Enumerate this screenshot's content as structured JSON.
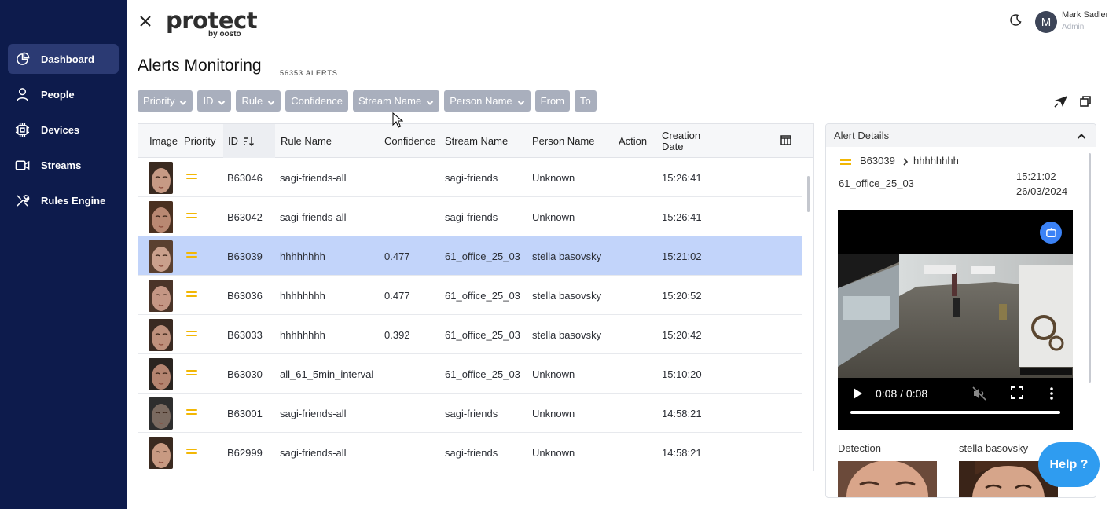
{
  "sidebar": {
    "items": [
      {
        "label": "Dashboard",
        "icon": "dashboard-icon",
        "active": true
      },
      {
        "label": "People",
        "icon": "person-icon"
      },
      {
        "label": "Devices",
        "icon": "chip-icon"
      },
      {
        "label": "Streams",
        "icon": "video-camera-icon"
      },
      {
        "label": "Rules Engine",
        "icon": "tools-icon"
      }
    ]
  },
  "header": {
    "logo_main": "protect",
    "logo_sub": "by oosto",
    "user_initial": "M",
    "user_name": "Mark Sadler",
    "user_role": "Admin"
  },
  "page": {
    "title": "Alerts Monitoring",
    "count": "56353 ALERTS"
  },
  "filters": [
    {
      "label": "Priority",
      "dropdown": true
    },
    {
      "label": "ID",
      "dropdown": true
    },
    {
      "label": "Rule",
      "dropdown": true
    },
    {
      "label": "Confidence",
      "dropdown": false
    },
    {
      "label": "Stream Name",
      "dropdown": true
    },
    {
      "label": "Person Name",
      "dropdown": true
    },
    {
      "label": "From",
      "dropdown": false
    },
    {
      "label": "To",
      "dropdown": false
    }
  ],
  "table": {
    "headers": {
      "image": "Image",
      "priority": "Priority",
      "id": "ID",
      "rule": "Rule Name",
      "confidence": "Confidence",
      "stream": "Stream Name",
      "person": "Person Name",
      "action": "Action",
      "date_line1": "Creation",
      "date_line2": "Date"
    },
    "rows": [
      {
        "id": "B63046",
        "rule": "sagi-friends-all",
        "confidence": "",
        "stream": "sagi-friends",
        "person": "Unknown",
        "time": "15:26:41",
        "selected": false
      },
      {
        "id": "B63042",
        "rule": "sagi-friends-all",
        "confidence": "",
        "stream": "sagi-friends",
        "person": "Unknown",
        "time": "15:26:41",
        "selected": false
      },
      {
        "id": "B63039",
        "rule": "hhhhhhhh",
        "confidence": "0.477",
        "stream": "61_office_25_03",
        "person": "stella basovsky",
        "time": "15:21:02",
        "selected": true
      },
      {
        "id": "B63036",
        "rule": "hhhhhhhh",
        "confidence": "0.477",
        "stream": "61_office_25_03",
        "person": "stella basovsky",
        "time": "15:20:52",
        "selected": false
      },
      {
        "id": "B63033",
        "rule": "hhhhhhhh",
        "confidence": "0.392",
        "stream": "61_office_25_03",
        "person": "stella basovsky",
        "time": "15:20:42",
        "selected": false
      },
      {
        "id": "B63030",
        "rule": "all_61_5min_interval",
        "confidence": "",
        "stream": "61_office_25_03",
        "person": "Unknown",
        "time": "15:10:20",
        "selected": false
      },
      {
        "id": "B63001",
        "rule": "sagi-friends-all",
        "confidence": "",
        "stream": "sagi-friends",
        "person": "Unknown",
        "time": "14:58:21",
        "selected": false
      },
      {
        "id": "B62999",
        "rule": "sagi-friends-all",
        "confidence": "",
        "stream": "sagi-friends",
        "person": "Unknown",
        "time": "14:58:21",
        "selected": false
      }
    ]
  },
  "details": {
    "title": "Alert Details",
    "id": "B63039",
    "rule": "hhhhhhhh",
    "stream": "61_office_25_03",
    "time": "15:21:02",
    "date": "26/03/2024",
    "video_time": "0:08 / 0:08",
    "video_progress": 1.0,
    "detection_label": "Detection",
    "match_label": "stella basovsky"
  },
  "help_label": "Help ?",
  "colors": {
    "sidebar_bg": "#0d1b4c",
    "accent": "#2f9cf0",
    "selected_row": "#c2d4fa",
    "priority": "#f2b705",
    "filter_bg": "#a9afbd"
  }
}
